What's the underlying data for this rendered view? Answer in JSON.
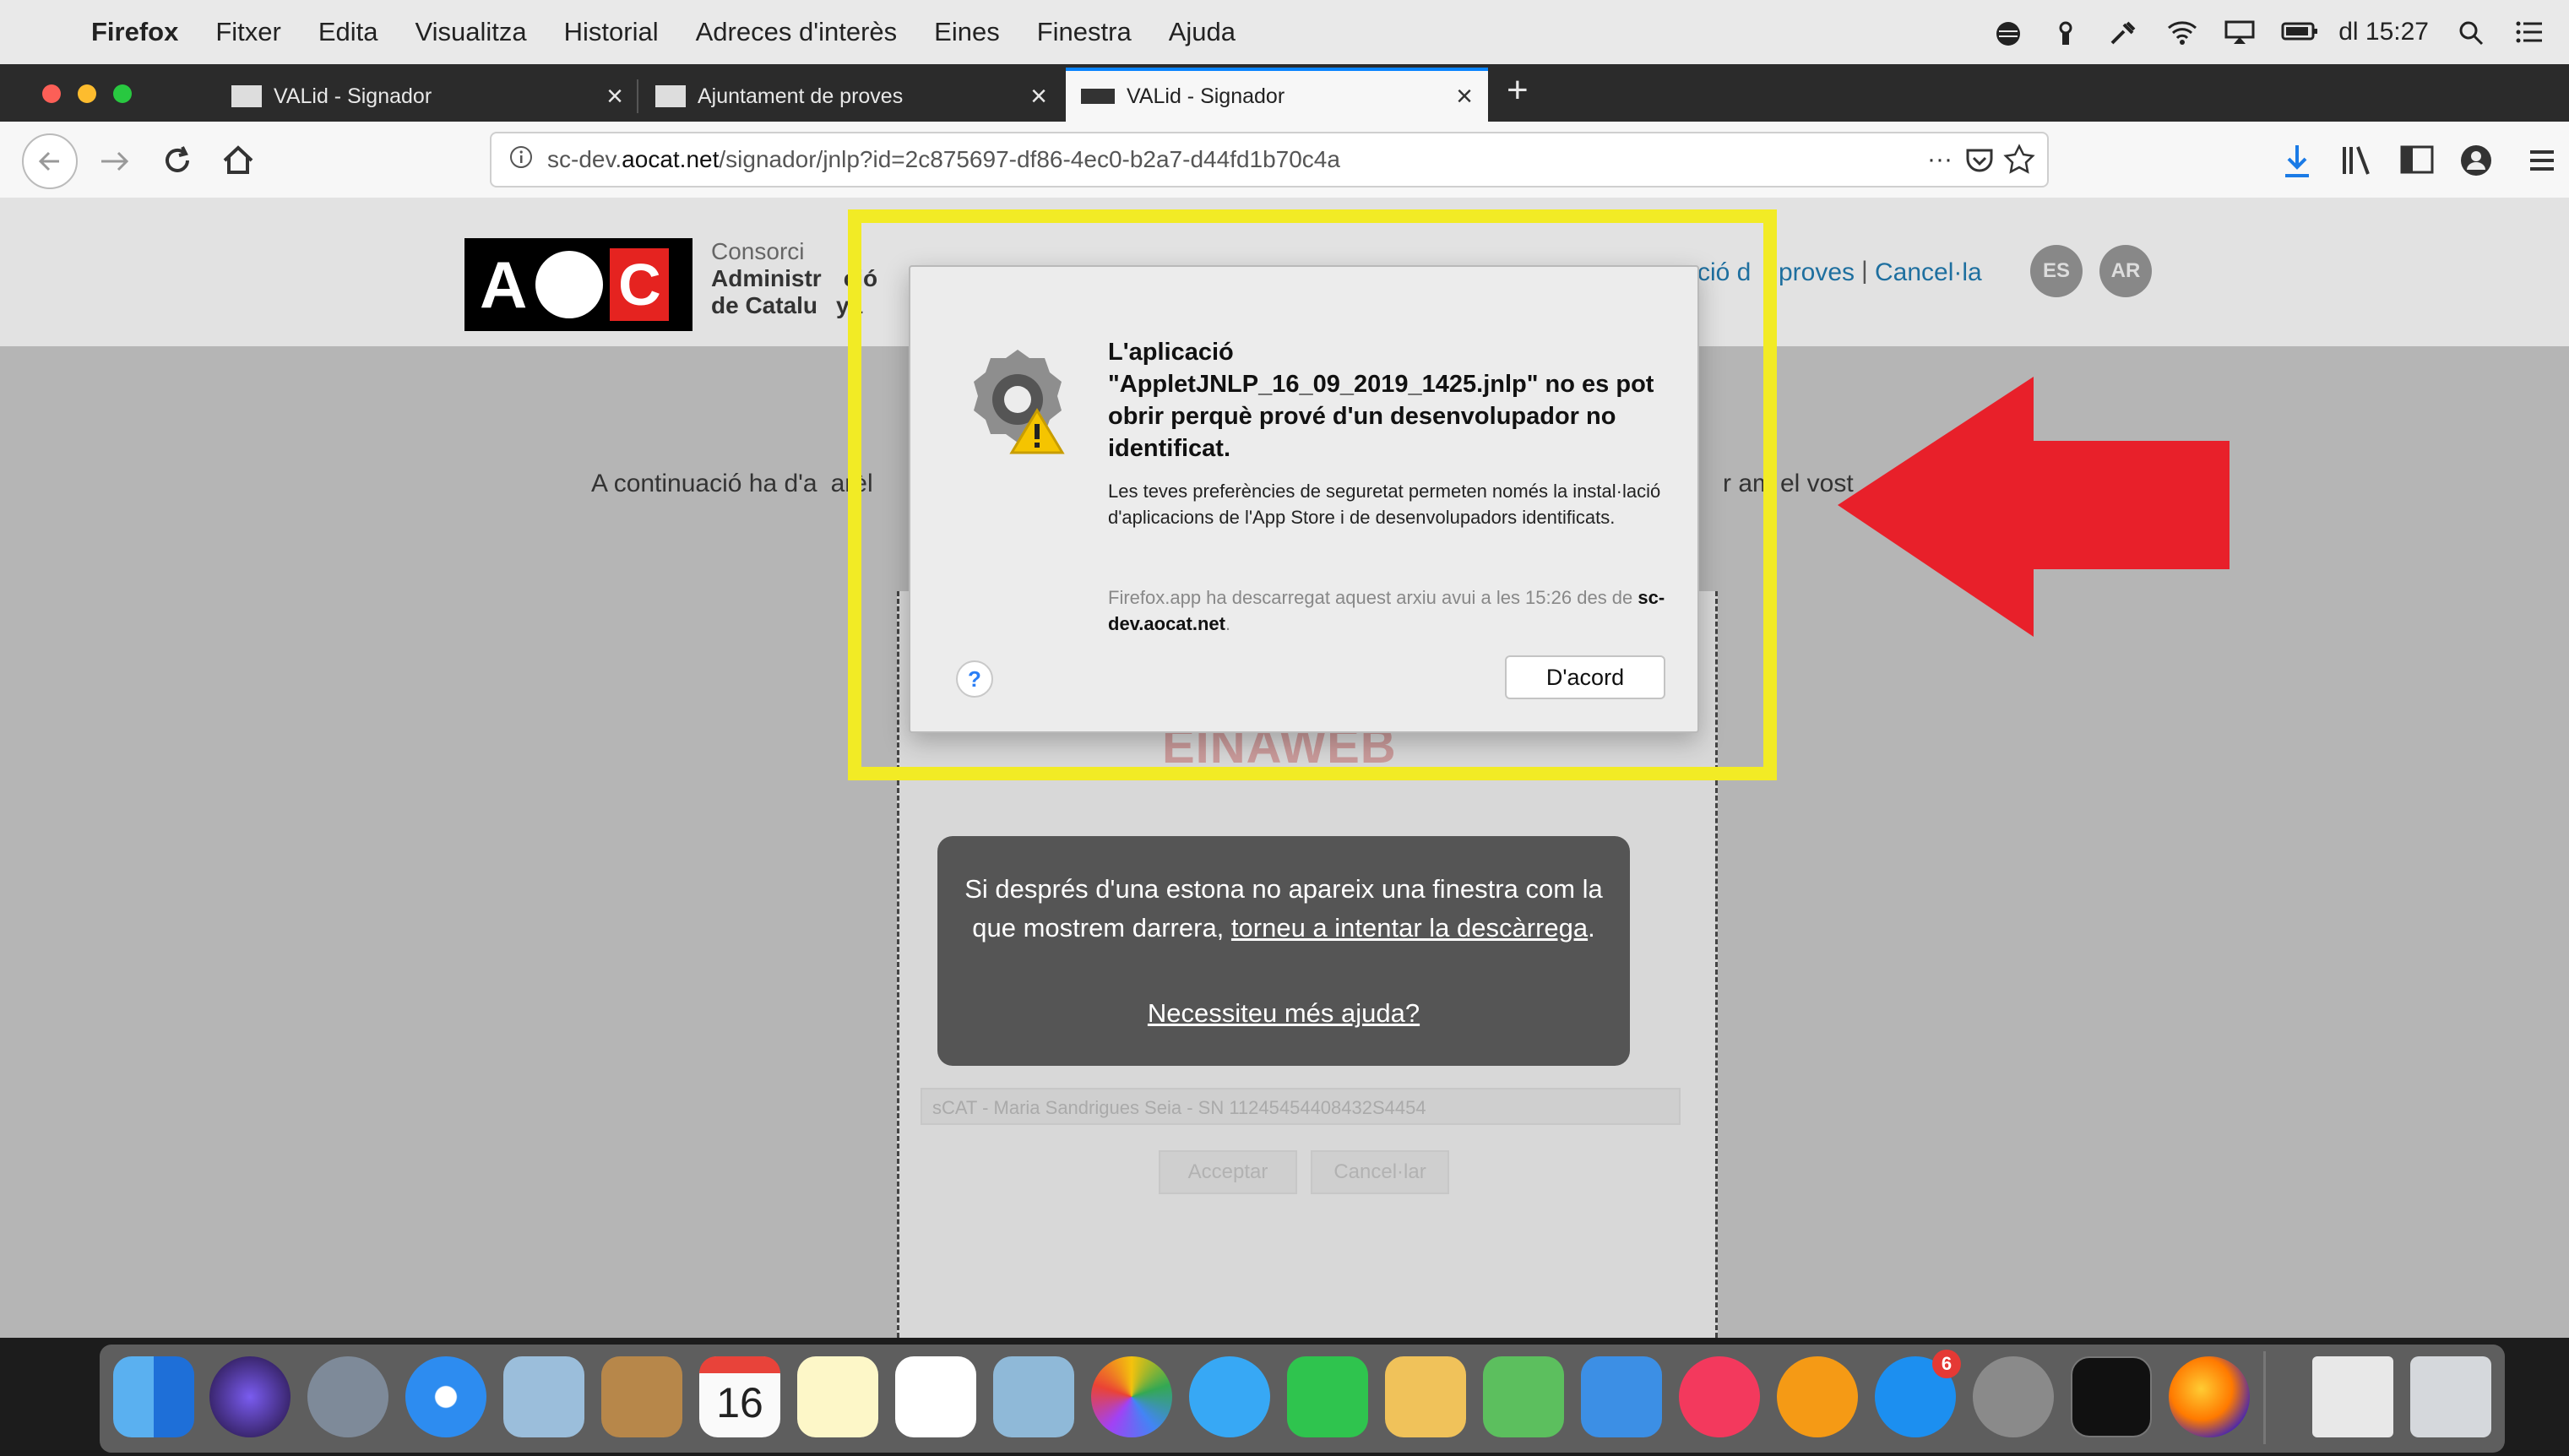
{
  "menubar": {
    "items": [
      "Firefox",
      "Fitxer",
      "Edita",
      "Visualitza",
      "Historial",
      "Adreces d'interès",
      "Eines",
      "Finestra",
      "Ajuda"
    ],
    "clock": "dl 15:27"
  },
  "tabs": [
    {
      "label": "VALid - Signador",
      "active": false
    },
    {
      "label": "Ajuntament de proves",
      "active": false
    },
    {
      "label": "VALid - Signador",
      "active": true
    }
  ],
  "urlbar": {
    "prefix": "sc-dev.",
    "host": "aocat.net",
    "path": "/signador/jnlp?id=2c875697-df86-4ec0-b2a7-d44fd1b70c4a",
    "more": "···"
  },
  "page_header": {
    "logo_text_a": "A",
    "logo_text_c": "C",
    "consorci_line1": "Consorci",
    "consorci_line2": "Administr",
    "consorci_line2b": "ció",
    "consorci_line3": "de Catalu",
    "consorci_line3b": "ya",
    "link_fragment": "ció d",
    "link_fragment2": "proves",
    "separator": "|",
    "cancel_link": "Cancel·la",
    "lang_es": "ES",
    "lang_ar": "AR"
  },
  "intro": {
    "left": "A continuació ha d'a",
    "left2": "arèl",
    "right": "r am",
    "right2": "el vost"
  },
  "card": {
    "einaweb": "EINAWEB",
    "faint_select": "sCAT - Maria Sandrigues Seia - SN 11245454408432S4454",
    "accept": "Acceptar",
    "cancel": "Cancel·lar"
  },
  "darkbox": {
    "message_before": "Si després d'una estona no apareix una finestra com la que mostrem darrera, ",
    "message_link": "torneu a intentar la descàrrega",
    "message_after": ".",
    "help_link": "Necessiteu més ajuda?"
  },
  "dialog": {
    "title": "L'aplicació \"AppletJNLP_16_09_2019_1425.jnlp\" no es pot obrir perquè prové d'un desenvolupador no identificat.",
    "body": "Les teves preferències de seguretat permeten només la instal·lació d'aplicacions de l'App Store i de desenvolupadors identificats.",
    "source_before": "Firefox.app ha descarregat aquest arxiu avui a les 15:26 des de ",
    "source_host": "sc-dev.aocat.net",
    "source_after": ".",
    "help_icon": "?",
    "ok_button": "D'acord"
  },
  "dock": {
    "calendar_day": "16",
    "appstore_badge": "6"
  },
  "colors": {
    "highlight_yellow": "#f2eb25",
    "arrow_red": "#e8202a",
    "tab_active_accent": "#0a84ff"
  }
}
